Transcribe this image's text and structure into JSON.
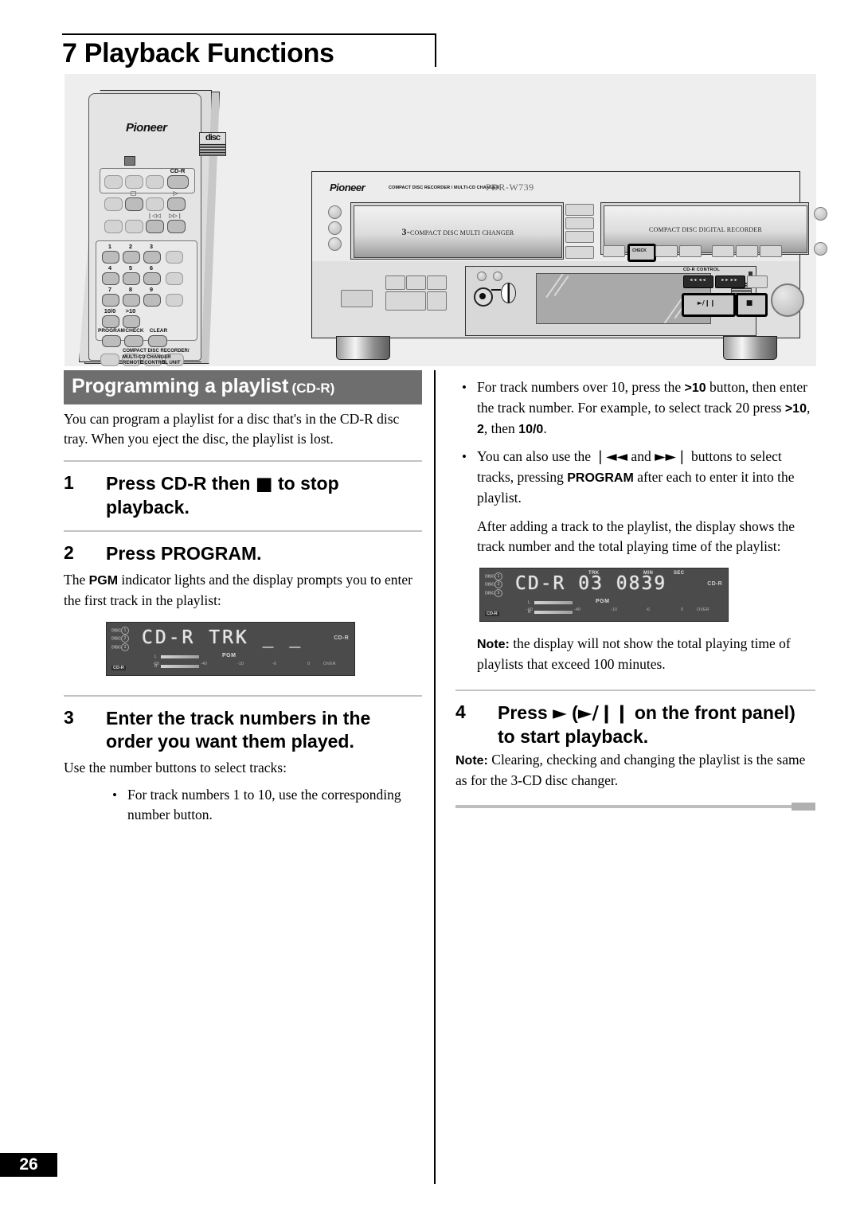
{
  "header": {
    "chapter_number": "7",
    "title": "7 Playback Functions"
  },
  "illustration": {
    "remote": {
      "brand": "Pioneer",
      "cd_logo_text": "disc",
      "cdr_button_label": "CD-R",
      "stop_glyph": "□",
      "play_glyph": "▷",
      "prev_glyph": "❘◁◁",
      "next_glyph": "▷▷❘",
      "number_keys": [
        "1",
        "2",
        "3",
        "4",
        "5",
        "6",
        "7",
        "8",
        "9"
      ],
      "key_10_0": "10/0",
      "key_over_10": ">10",
      "program_label": "PROGRAM",
      "check_label": "CHECK",
      "clear_label": "CLEAR",
      "footer_line1": "COMPACT DISC RECORDER/",
      "footer_line2": "MULTI-CD CHANGER",
      "footer_line3": "REMOTE CONTROL UNIT"
    },
    "deck": {
      "brand": "Pioneer",
      "subtitle": "COMPACT DISC RECORDER / MULTI-CD CHANGER",
      "model": "PDR-W739",
      "left_tray_prefix": "3-",
      "left_tray_text": "COMPACT DISC MULTI CHANGER",
      "right_tray_text": "COMPACT DISC DIGITAL RECORDER",
      "check_button_label": "CHECK",
      "cdr_control_label": "CD-R CONTROL",
      "prev_button_glyph": "◄◄ ◄◄",
      "next_button_glyph": "►► ►►",
      "play_pause_label": "►/❙❙",
      "stop_label": "■"
    }
  },
  "left_column": {
    "section": {
      "title": "Programming a playlist",
      "subtitle": "(CD-R)"
    },
    "intro": "You can program a playlist for a disc that's in the CD-R disc tray. When you eject the disc, the playlist is lost.",
    "steps": [
      {
        "number": "1",
        "heading_pre": "Press CD-R then ",
        "heading_glyph": "■",
        "heading_post": " to stop playback."
      },
      {
        "number": "2",
        "heading": "Press PROGRAM.",
        "body_pre": "The ",
        "body_bold": "PGM",
        "body_post": " indicator lights and the display prompts you to enter the first track in the playlist:"
      },
      {
        "number": "3",
        "heading": "Enter the track numbers in the order you want them played.",
        "body": "Use the number buttons to select tracks:",
        "bullets": [
          "For track numbers 1 to 10, use the corresponding number button."
        ]
      }
    ],
    "display_1": {
      "disc_label": "DISC",
      "disc_numbers": [
        "1",
        "2",
        "3"
      ],
      "main_text": "CD-R  TRK _ _",
      "pgm_indicator": "PGM",
      "source_indicator": "CD-R",
      "right_indicator": "CD-R",
      "meter": {
        "left_label": "L",
        "right_label": "R",
        "scale": [
          "-60",
          "-40",
          "-10",
          "-6",
          "0",
          "OVER"
        ]
      }
    }
  },
  "right_column": {
    "bullets": [
      {
        "parts": [
          {
            "t": "For track numbers over 10, press the ",
            "b": false
          },
          {
            "t": ">10",
            "b": true
          },
          {
            "t": " button, then enter the track number. For example, to select track 20 press ",
            "b": false
          },
          {
            "t": ">10",
            "b": true
          },
          {
            "t": ", ",
            "b": false
          },
          {
            "t": "2",
            "b": true
          },
          {
            "t": ", then ",
            "b": false
          },
          {
            "t": "10/0",
            "b": true
          },
          {
            "t": ".",
            "b": false
          }
        ]
      },
      {
        "parts": [
          {
            "t": "You can also use the ",
            "b": false
          },
          {
            "t": "❘◄◄",
            "b": true
          },
          {
            "t": " and ",
            "b": false
          },
          {
            "t": "►►❘",
            "b": true
          },
          {
            "t": " buttons to select tracks, pressing ",
            "b": false
          },
          {
            "t": "PROGRAM",
            "b": true
          },
          {
            "t": " after each to enter it into the playlist.",
            "b": false
          }
        ]
      }
    ],
    "after_adding": "After adding a track to the playlist, the display shows the track number and the total playing time of the playlist:",
    "display_2": {
      "disc_label": "DISC",
      "disc_numbers": [
        "1",
        "2",
        "3"
      ],
      "main_text": "CD-R  03  0839",
      "track_label": "TRK",
      "min_label": "MIN",
      "sec_label": "SEC",
      "track_value": "03",
      "time_value": "0839",
      "pgm_indicator": "PGM",
      "source_indicator": "CD-R",
      "right_indicator": "CD-R",
      "meter": {
        "left_label": "L",
        "right_label": "R",
        "scale": [
          "-60",
          "-40",
          "-10",
          "-6",
          "0",
          "OVER"
        ]
      }
    },
    "note_1_label": "Note:",
    "note_1_text": " the display will not show the total playing time of playlists that exceed 100 minutes.",
    "step_4": {
      "number": "4",
      "heading_pre": "Press ",
      "heading_glyph_1": "►",
      "heading_mid": " (",
      "heading_glyph_2": "►/❙❙",
      "heading_post": " on the front panel) to start playback."
    },
    "note_2_label": "Note:",
    "note_2_text": " Clearing, checking and changing the playlist is the same as for the 3-CD disc changer."
  },
  "footer": {
    "page_number": "26"
  },
  "colors": {
    "banner_bg": "#6e6e6e",
    "lcd_bg": "#4b4b4b",
    "rule_gray": "#c3c3c3",
    "page_box": "#000000"
  }
}
